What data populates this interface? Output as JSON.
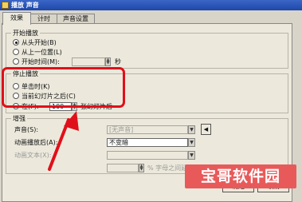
{
  "window": {
    "title": "播放 声音"
  },
  "tabs": [
    {
      "label": "效果"
    },
    {
      "label": "计时"
    },
    {
      "label": "声音设置"
    }
  ],
  "start_playback": {
    "legend": "开始播放",
    "options": [
      {
        "label": "从头开始(B)",
        "selected": true
      },
      {
        "label": "从上一位置(L)",
        "selected": false
      },
      {
        "label": "开始时间(M):",
        "selected": false
      }
    ],
    "time_value": "",
    "time_unit": "秒"
  },
  "stop_playback": {
    "legend": "停止播放",
    "options": [
      {
        "label": "单击时(K)",
        "selected": false
      },
      {
        "label": "当前幻灯片之后(C)",
        "selected": false
      },
      {
        "label": "在(F):",
        "selected": true
      }
    ],
    "slide_count": "100",
    "slide_suffix": "张幻灯片后"
  },
  "enhancements": {
    "legend": "增强",
    "sound_label": "声音(S):",
    "sound_value": "[无声音]",
    "after_anim_label": "动画播放后(A):",
    "after_anim_value": "不变暗",
    "anim_text_label": "动画文本(X):",
    "anim_text_value": "",
    "letter_suffix": "% 字母之间延迟"
  },
  "buttons": {
    "ok": "确定",
    "cancel": "取消"
  },
  "watermark": {
    "text": "宝哥软件园"
  },
  "colors": {
    "highlight": "#e0101a",
    "watermark_bg": "#e85a5a",
    "title_bar": "#1f48a8"
  }
}
